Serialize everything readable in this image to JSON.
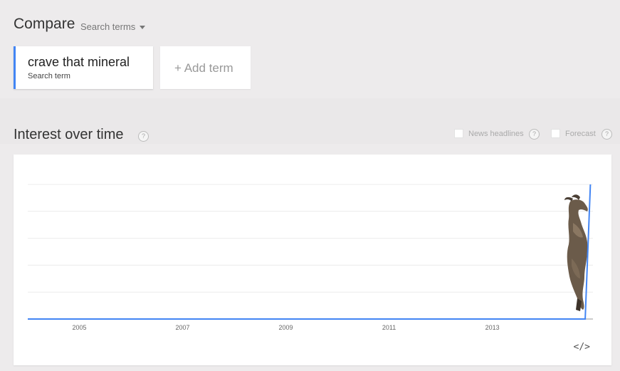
{
  "header": {
    "title": "Compare",
    "dropdown_label": "Search terms"
  },
  "terms": {
    "term_name": "crave that mineral",
    "term_type": "Search term",
    "add_label": "+ Add term",
    "accent_color": "#4285f4"
  },
  "interest": {
    "title": "Interest over time",
    "help_glyph": "?",
    "news_label": "News headlines",
    "forecast_label": "Forecast",
    "embed_glyph": "</>"
  },
  "chart_data": {
    "type": "line",
    "title": "",
    "xlabel": "",
    "ylabel": "",
    "x_ticks": [
      "2005",
      "2007",
      "2009",
      "2011",
      "2013"
    ],
    "series": [
      {
        "color": "#4285f4",
        "x": [
          2004.0,
          2014.8,
          2014.9
        ],
        "values": [
          0,
          0,
          100
        ]
      }
    ],
    "xlim": [
      2004.0,
      2014.95
    ],
    "ylim": [
      0,
      100
    ],
    "grid": true,
    "image_overlay": "goat-photo"
  }
}
